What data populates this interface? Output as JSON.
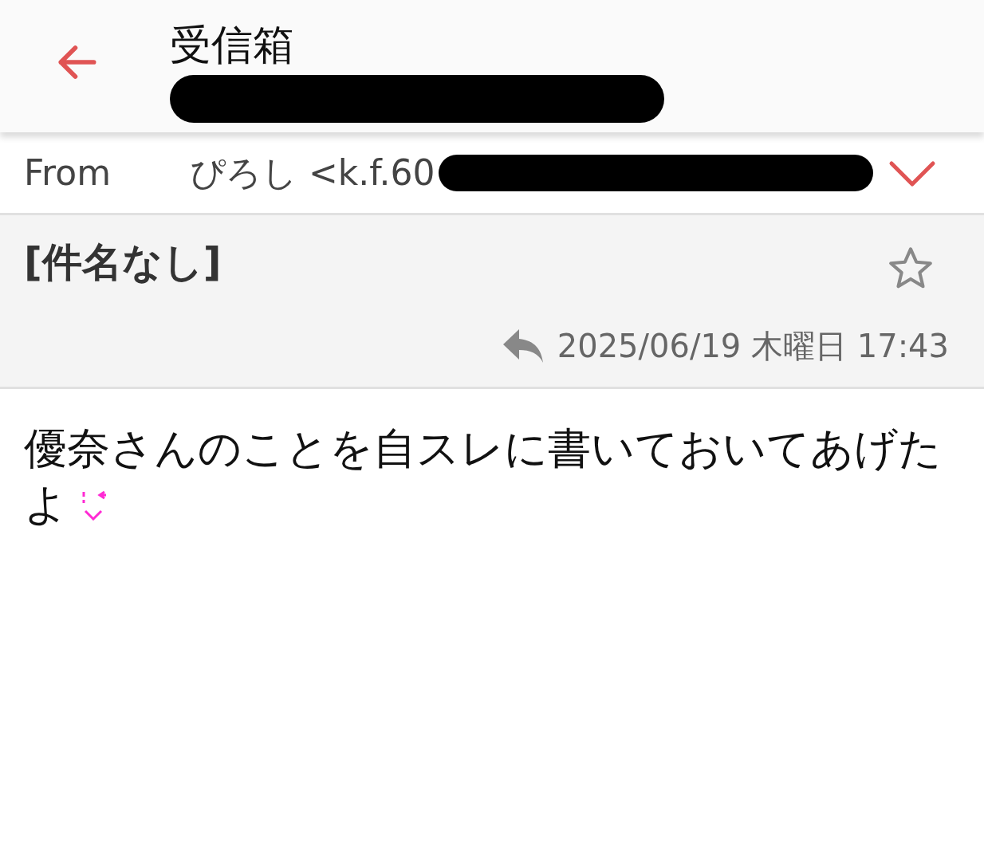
{
  "header": {
    "title": "受信箱",
    "subtitle_redacted": true
  },
  "from": {
    "label": "From",
    "sender": "ぴろし <k.f.60",
    "address_redacted": true,
    "expanded": false
  },
  "message": {
    "subject": "[件名なし]",
    "starred": false,
    "replied": true,
    "date": "2025/06/19 木曜日 17:43"
  },
  "body": {
    "lines": [
      "優奈さんのことを自スレに書いておいてあげた",
      "よ"
    ]
  }
}
